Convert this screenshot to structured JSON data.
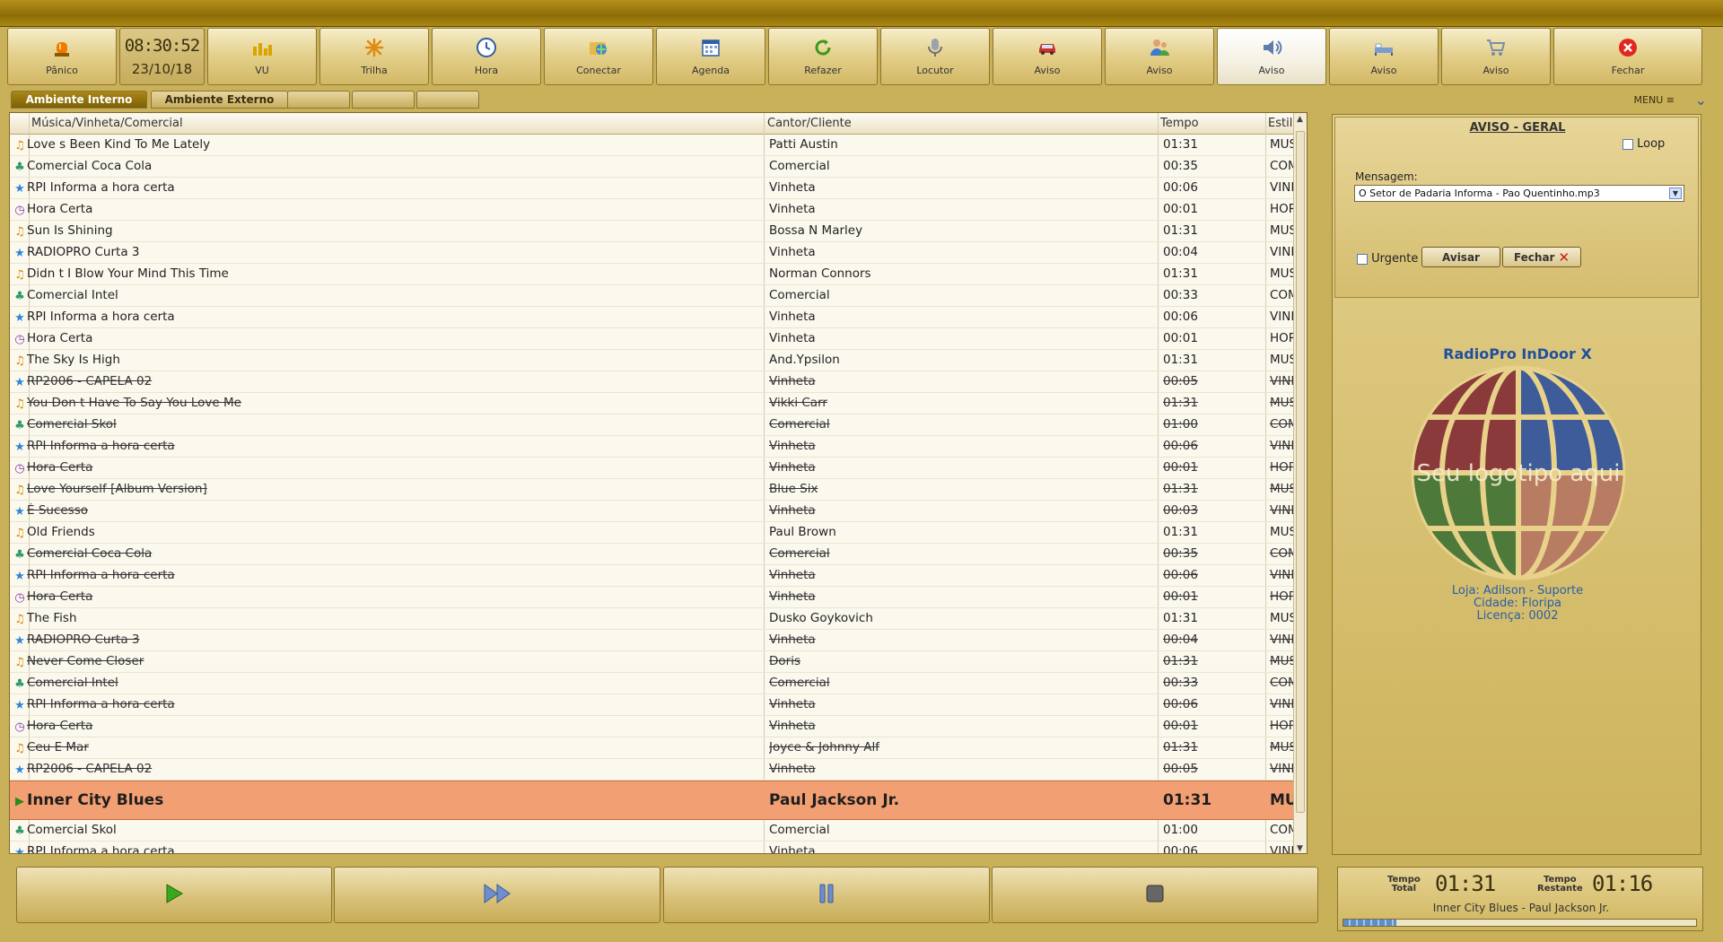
{
  "titlebar": {},
  "toolbar": {
    "panic": "Pânico",
    "clock_time": "08:30:52",
    "clock_date": "23/10/18",
    "buttons": [
      "VU",
      "Trilha",
      "Hora",
      "Conectar",
      "Agenda",
      "Refazer",
      "Locutor",
      "Aviso",
      "Aviso",
      "Aviso",
      "Aviso",
      "Aviso",
      "Fechar"
    ]
  },
  "tabs": {
    "internal": "Ambiente Interno",
    "external": "Ambiente Externo",
    "menu": "MENU"
  },
  "list": {
    "headers": {
      "track": "Música/Vinheta/Comercial",
      "artist": "Cantor/Cliente",
      "time": "Tempo",
      "style": "Estilo"
    },
    "rows": [
      {
        "type": "music",
        "track": "Love s Been Kind To Me Lately",
        "artist": "Patti Austin",
        "time": "01:31",
        "style": "MUSICA",
        "played": false
      },
      {
        "type": "commercial",
        "track": "Comercial Coca Cola",
        "artist": "Comercial",
        "time": "00:35",
        "style": "COMERCIAL",
        "played": false
      },
      {
        "type": "jingle",
        "track": "RPI Informa a hora certa",
        "artist": "Vinheta",
        "time": "00:06",
        "style": "VINHETA",
        "played": false
      },
      {
        "type": "hour",
        "track": "Hora Certa",
        "artist": "Vinheta",
        "time": "00:01",
        "style": "HORAS",
        "played": false
      },
      {
        "type": "music",
        "track": "Sun Is Shining",
        "artist": "Bossa  N  Marley",
        "time": "01:31",
        "style": "MUSICA",
        "played": false
      },
      {
        "type": "jingle",
        "track": "RADIOPRO Curta 3",
        "artist": "Vinheta",
        "time": "00:04",
        "style": "VINHETA",
        "played": false
      },
      {
        "type": "music",
        "track": "Didn t I  Blow Your Mind This Time",
        "artist": "Norman Connors",
        "time": "01:31",
        "style": "MUSICA",
        "played": false
      },
      {
        "type": "commercial",
        "track": "Comercial Intel",
        "artist": "Comercial",
        "time": "00:33",
        "style": "COMERCIAL",
        "played": false
      },
      {
        "type": "jingle",
        "track": "RPI Informa a hora certa",
        "artist": "Vinheta",
        "time": "00:06",
        "style": "VINHETA",
        "played": false
      },
      {
        "type": "hour",
        "track": "Hora Certa",
        "artist": "Vinheta",
        "time": "00:01",
        "style": "HORAS",
        "played": false
      },
      {
        "type": "music",
        "track": "The Sky Is High",
        "artist": "And.Ypsilon",
        "time": "01:31",
        "style": "MUSICA",
        "played": false
      },
      {
        "type": "jingle",
        "track": "RP2006 - CAPELA 02",
        "artist": "Vinheta",
        "time": "00:05",
        "style": "VINHETA",
        "played": true
      },
      {
        "type": "music",
        "track": "You Don t Have To Say You Love Me",
        "artist": "Vikki Carr",
        "time": "01:31",
        "style": "MUSICA",
        "played": true
      },
      {
        "type": "commercial",
        "track": "Comercial Skol",
        "artist": "Comercial",
        "time": "01:00",
        "style": "COMERCIAL",
        "played": true
      },
      {
        "type": "jingle",
        "track": "RPI Informa a hora certa",
        "artist": "Vinheta",
        "time": "00:06",
        "style": "VINHETA",
        "played": true
      },
      {
        "type": "hour",
        "track": "Hora Certa",
        "artist": "Vinheta",
        "time": "00:01",
        "style": "HORAS",
        "played": true
      },
      {
        "type": "music",
        "track": "Love Yourself [Album Version]",
        "artist": "Blue Six",
        "time": "01:31",
        "style": "MUSICA",
        "played": true
      },
      {
        "type": "jingle",
        "track": "É Sucesso",
        "artist": "Vinheta",
        "time": "00:03",
        "style": "VINHETA",
        "played": true
      },
      {
        "type": "music",
        "track": "Old Friends",
        "artist": "Paul Brown",
        "time": "01:31",
        "style": "MUSICA",
        "played": false
      },
      {
        "type": "commercial",
        "track": "Comercial Coca Cola",
        "artist": "Comercial",
        "time": "00:35",
        "style": "COMERCIAL",
        "played": true
      },
      {
        "type": "jingle",
        "track": "RPI Informa a hora certa",
        "artist": "Vinheta",
        "time": "00:06",
        "style": "VINHETA",
        "played": true
      },
      {
        "type": "hour",
        "track": "Hora Certa",
        "artist": "Vinheta",
        "time": "00:01",
        "style": "HORAS",
        "played": true
      },
      {
        "type": "music",
        "track": "The Fish",
        "artist": "Dusko Goykovich",
        "time": "01:31",
        "style": "MUSICA",
        "played": false
      },
      {
        "type": "jingle",
        "track": "RADIOPRO Curta 3",
        "artist": "Vinheta",
        "time": "00:04",
        "style": "VINHETA",
        "played": true
      },
      {
        "type": "music",
        "track": "Never Come Closer",
        "artist": "Doris",
        "time": "01:31",
        "style": "MUSICA",
        "played": true
      },
      {
        "type": "commercial",
        "track": "Comercial Intel",
        "artist": "Comercial",
        "time": "00:33",
        "style": "COMERCIAL",
        "played": true
      },
      {
        "type": "jingle",
        "track": "RPI Informa a hora certa",
        "artist": "Vinheta",
        "time": "00:06",
        "style": "VINHETA",
        "played": true
      },
      {
        "type": "hour",
        "track": "Hora Certa",
        "artist": "Vinheta",
        "time": "00:01",
        "style": "HORAS",
        "played": true
      },
      {
        "type": "music",
        "track": "Ceu E Mar",
        "artist": "Joyce & Johnny Alf",
        "time": "01:31",
        "style": "MUSICA",
        "played": true
      },
      {
        "type": "jingle",
        "track": "RP2006 - CAPELA 02",
        "artist": "Vinheta",
        "time": "00:05",
        "style": "VINHETA",
        "played": true
      },
      {
        "type": "current",
        "track": "Inner City Blues",
        "artist": "Paul Jackson Jr.",
        "time": "01:31",
        "style": "MUSICA",
        "played": false
      },
      {
        "type": "commercial",
        "track": "Comercial Skol",
        "artist": "Comercial",
        "time": "01:00",
        "style": "COMERCIAL",
        "played": false
      },
      {
        "type": "jingle",
        "track": "RPI Informa a hora certa",
        "artist": "Vinheta",
        "time": "00:06",
        "style": "VINHETA",
        "played": false
      }
    ]
  },
  "aviso": {
    "title": "AVISO - GERAL",
    "loop": "Loop",
    "message_label": "Mensagem:",
    "message_value": "O Setor de Padaria Informa - Pao Quentinho.mp3",
    "urgent": "Urgente",
    "send": "Avisar",
    "close": "Fechar"
  },
  "brand": {
    "title": "RadioPro InDoor X",
    "logo_text": "Seu logotipo aqui",
    "store": "Loja: Adilson - Suporte",
    "city": "Cidade: Floripa",
    "license": "Licença: 0002"
  },
  "player": {
    "total_label_1": "Tempo",
    "total_label_2": "Total",
    "total_value": "01:31",
    "remaining_label_1": "Tempo",
    "remaining_label_2": "Restante",
    "remaining_value": "01:16",
    "now_playing": "Inner City Blues - Paul Jackson Jr.",
    "progress": 0.15
  },
  "colors": {
    "gold": "#c9b15a",
    "current_row": "#f2a073",
    "accent_blue": "#2a5ea8"
  }
}
